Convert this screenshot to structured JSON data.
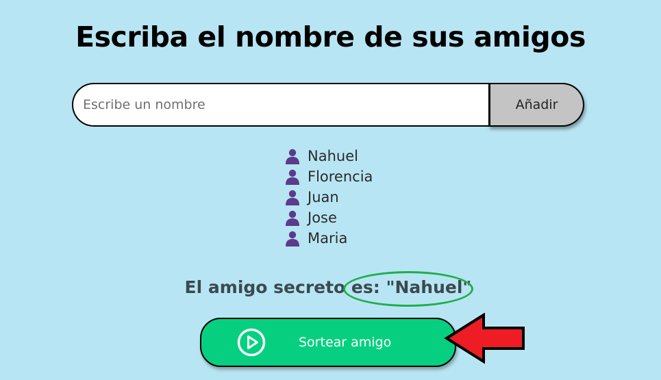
{
  "header": {
    "title": "Escriba el nombre de sus amigos"
  },
  "input": {
    "placeholder": "Escribe un nombre",
    "value": ""
  },
  "add_button": {
    "label": "Añadir"
  },
  "friends": [
    {
      "name": "Nahuel",
      "icon": "person-icon"
    },
    {
      "name": "Florencia",
      "icon": "person-icon"
    },
    {
      "name": "Juan",
      "icon": "person-icon"
    },
    {
      "name": "Jose",
      "icon": "person-icon"
    },
    {
      "name": "Maria",
      "icon": "person-icon"
    }
  ],
  "result": {
    "text": "El amigo secreto es: \"Nahuel\""
  },
  "draw_button": {
    "label": "Sortear amigo",
    "icon": "play-icon"
  },
  "annotations": {
    "ellipse_color": "#1fae4a",
    "arrow_color": "#ee1c24"
  },
  "colors": {
    "background": "#b8e5f3",
    "accent": "#06d07f",
    "icon": "#5b3b8c"
  }
}
